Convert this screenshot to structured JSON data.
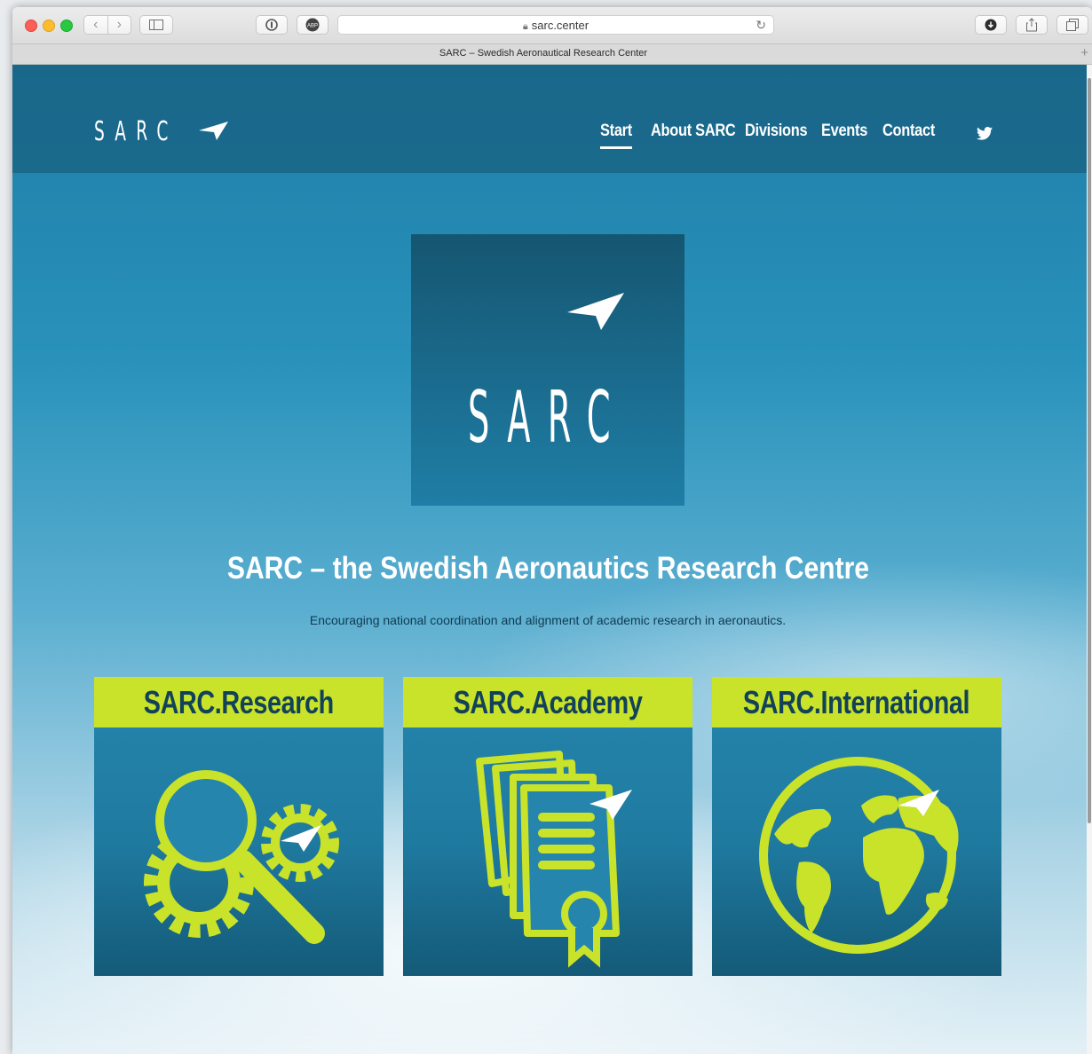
{
  "browser": {
    "address": "sarc.center",
    "tab_title": "SARC – Swedish Aeronautical Research Center"
  },
  "site": {
    "brand": "SARC",
    "nav": [
      {
        "label": "Start",
        "active": true
      },
      {
        "label": "About SARC"
      },
      {
        "label": "Divisions"
      },
      {
        "label": "Events"
      },
      {
        "label": "Contact"
      }
    ],
    "hero_logo_text": "SARC",
    "headline": "SARC – the Swedish Aeronautics Research Centre",
    "tagline": "Encouraging national coordination and alignment of academic research in aeronautics.",
    "cards": [
      {
        "title": "SARC.Research",
        "icon": "research-gear-magnifier-icon"
      },
      {
        "title": "SARC.Academy",
        "icon": "academy-documents-certificate-icon"
      },
      {
        "title": "SARC.International",
        "icon": "international-globe-icon"
      }
    ]
  },
  "colors": {
    "header_bg": "#1e6e8f",
    "accent_lime": "#c9e22a",
    "card_title": "#124259",
    "text_white": "#ffffff"
  }
}
